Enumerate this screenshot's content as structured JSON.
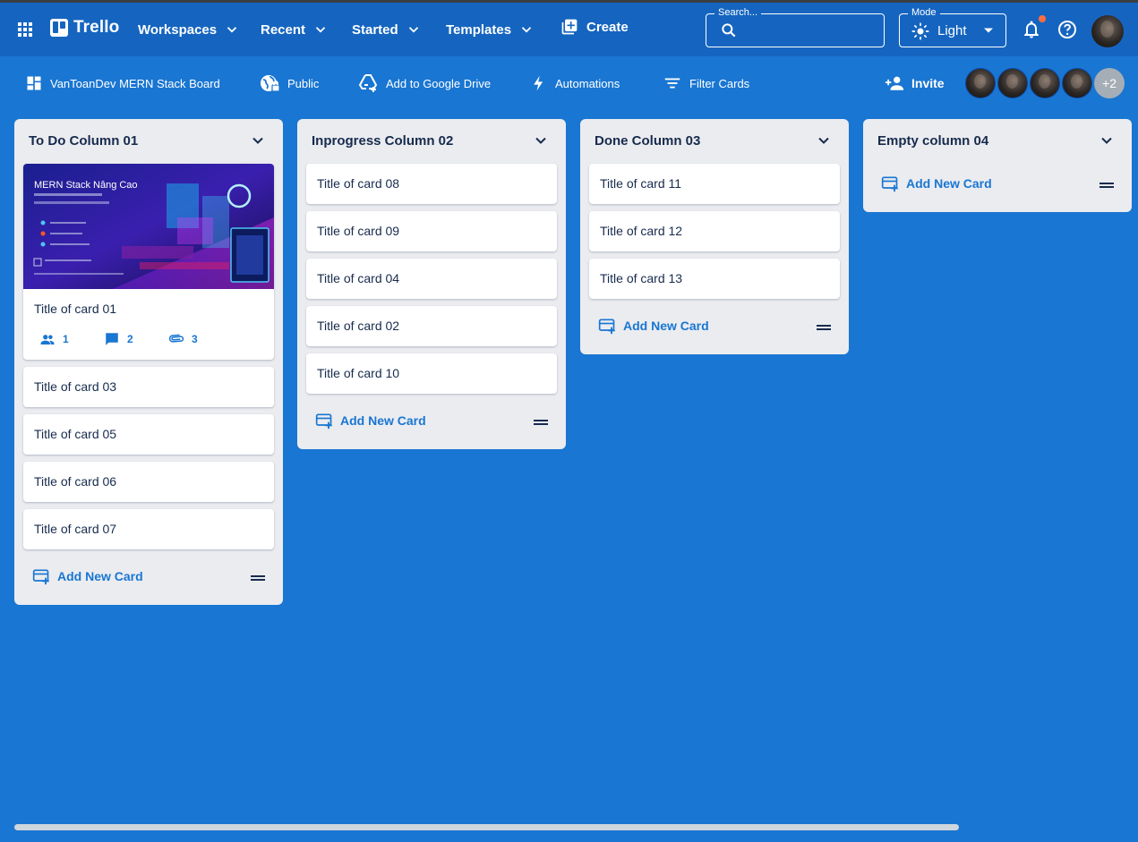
{
  "appbar": {
    "brand": "Trello",
    "menus": [
      {
        "label": "Workspaces"
      },
      {
        "label": "Recent"
      },
      {
        "label": "Started"
      },
      {
        "label": "Templates"
      }
    ],
    "create_label": "Create",
    "search": {
      "label": "Search...",
      "value": "",
      "placeholder": ""
    },
    "mode": {
      "label": "Mode",
      "value": "Light"
    },
    "has_notification": true
  },
  "board": {
    "title": "VanToanDev MERN Stack Board",
    "visibility": "Public",
    "drive_label": "Add to Google Drive",
    "automations_label": "Automations",
    "filter_label": "Filter Cards",
    "invite_label": "Invite",
    "more_members": "+2"
  },
  "columns": [
    {
      "title": "To Do Column 01",
      "cards": [
        {
          "title": "Title of card 01",
          "cover": true,
          "members": "1",
          "comments": "2",
          "attachments": "3"
        },
        {
          "title": "Title of card 03"
        },
        {
          "title": "Title of card 05"
        },
        {
          "title": "Title of card 06"
        },
        {
          "title": "Title of card 07"
        }
      ],
      "add_label": "Add New Card"
    },
    {
      "title": "Inprogress Column 02",
      "cards": [
        {
          "title": "Title of card 08"
        },
        {
          "title": "Title of card 09"
        },
        {
          "title": "Title of card 04"
        },
        {
          "title": "Title of card 02"
        },
        {
          "title": "Title of card 10"
        }
      ],
      "add_label": "Add New Card"
    },
    {
      "title": "Done Column 03",
      "cards": [
        {
          "title": "Title of card 11"
        },
        {
          "title": "Title of card 12"
        },
        {
          "title": "Title of card 13"
        }
      ],
      "add_label": "Add New Card"
    },
    {
      "title": "Empty column 04",
      "cards": [],
      "add_label": "Add New Card"
    }
  ],
  "cover_image": {
    "headline": "MERN Stack Nâng Cao"
  },
  "colors": {
    "appbar": "#1565c0",
    "board_bg": "#1976d2",
    "column_bg": "#ebecf0",
    "accent": "#1976d2",
    "notification": "#ff6d3f"
  }
}
